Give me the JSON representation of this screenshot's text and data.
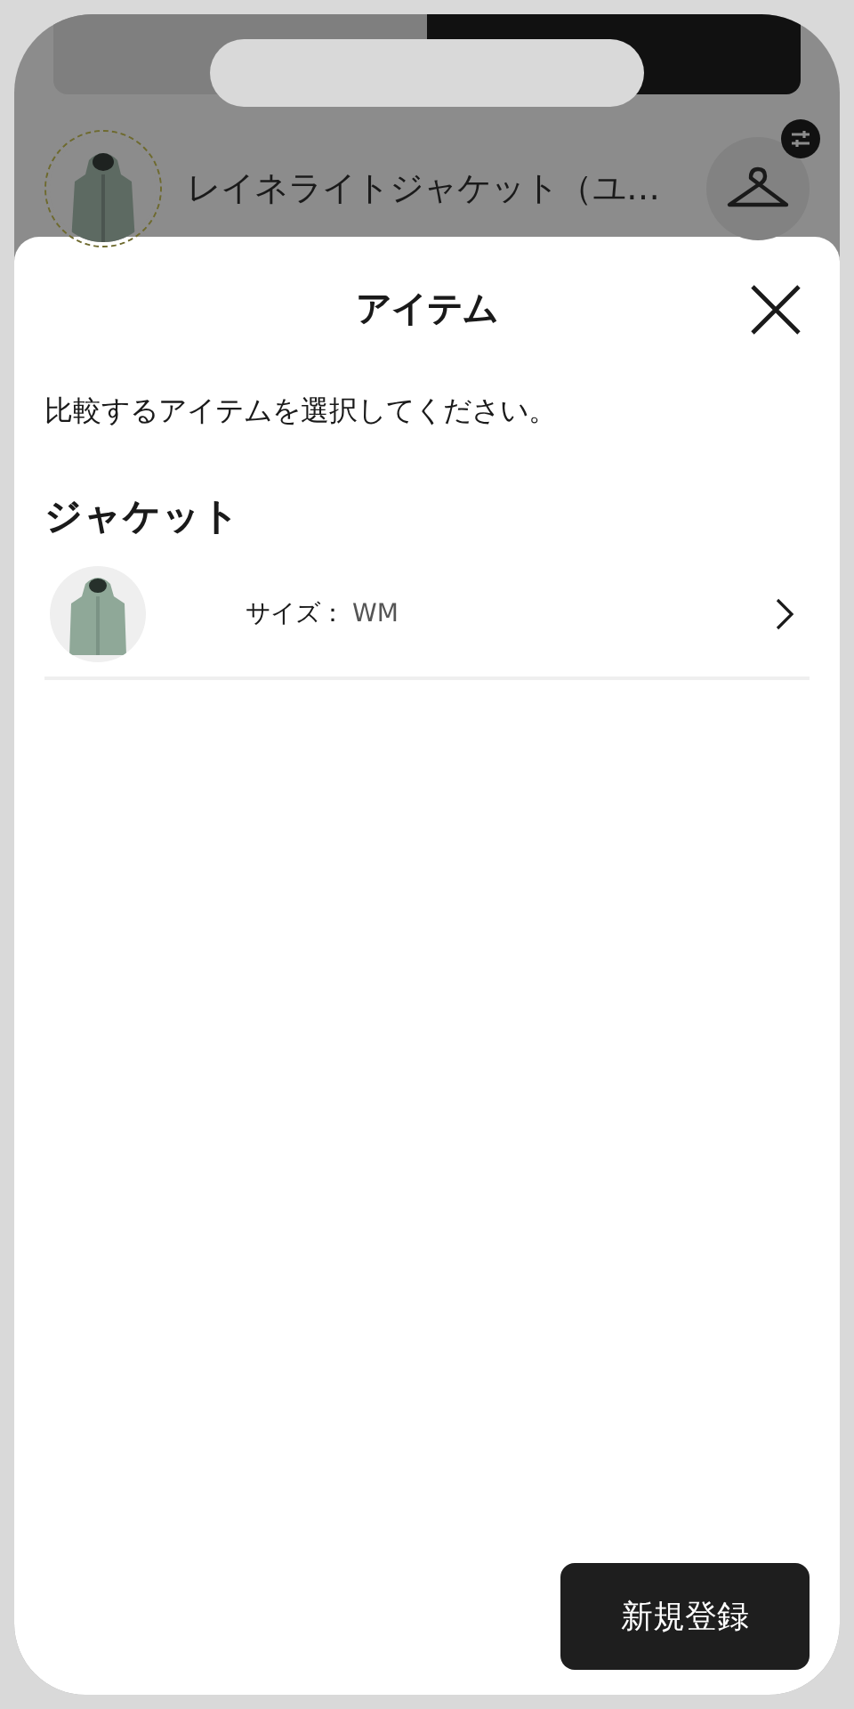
{
  "tabs": [
    {
      "selected": false
    },
    {
      "selected": true
    }
  ],
  "current_item": {
    "name": "レイネライトジャケット（ユ…"
  },
  "sheet": {
    "title": "アイテム",
    "instruction": "比較するアイテムを選択してください。",
    "sections": [
      {
        "heading": "ジャケット",
        "items": [
          {
            "size_label": "サイズ：",
            "size": "WM"
          }
        ]
      }
    ]
  },
  "primary_button": "新規登録"
}
